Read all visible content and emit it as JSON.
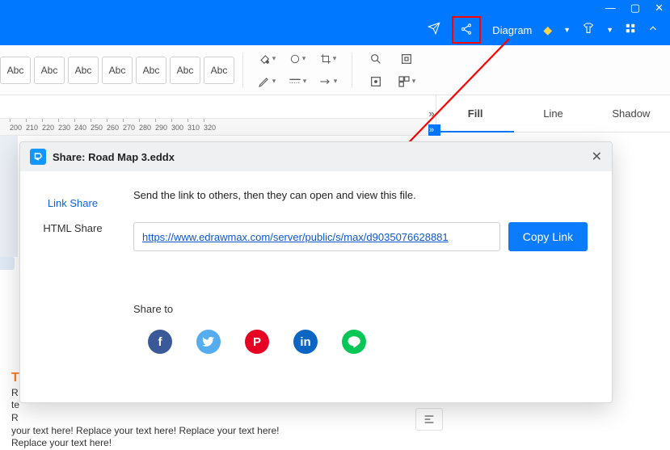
{
  "titlebar": {
    "diagram_label": "Diagram"
  },
  "ribbon": {
    "abc_labels": [
      "Abc",
      "Abc",
      "Abc",
      "Abc",
      "Abc",
      "Abc",
      "Abc"
    ]
  },
  "ruler": {
    "ticks": [
      "200",
      "210",
      "220",
      "230",
      "240",
      "250",
      "260",
      "270",
      "280",
      "290",
      "300",
      "310",
      "320"
    ]
  },
  "right_pane": {
    "tabs": [
      {
        "label": "Fill",
        "active": true
      },
      {
        "label": "Line",
        "active": false
      },
      {
        "label": "Shadow",
        "active": false
      }
    ]
  },
  "canvas": {
    "orange_T": "T",
    "sample_line1": "R",
    "sample_line2": "te",
    "sample_line3": "R",
    "sample_wrap": "your text here! Replace your text here!  Replace your text here! Replace your text here!"
  },
  "dialog": {
    "title": "Share: Road Map 3.eddx",
    "side_items": [
      {
        "label": "Link Share",
        "active": true
      },
      {
        "label": "HTML Share",
        "active": false
      }
    ],
    "instruction": "Send the link to others, then they can open and view this file.",
    "link_value": "https://www.edrawmax.com/server/public/s/max/d9035076628881",
    "copy_label": "Copy Link",
    "share_to_label": "Share to",
    "social": {
      "facebook": "f",
      "twitter": "t",
      "pinterest": "P",
      "linkedin": "in",
      "line": "L"
    }
  }
}
